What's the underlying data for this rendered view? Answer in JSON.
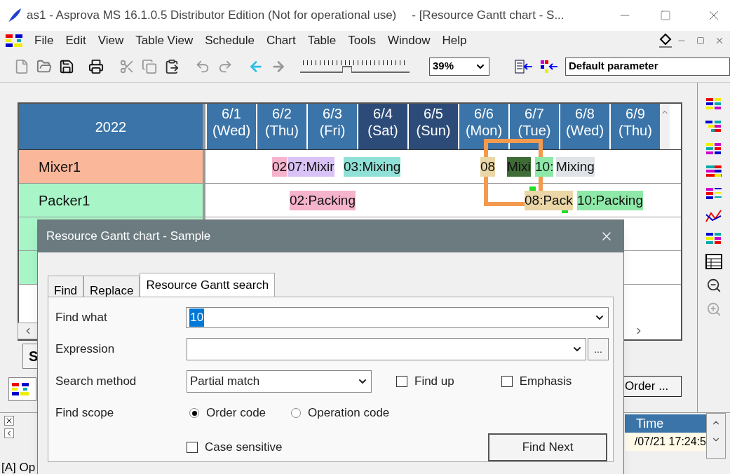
{
  "window": {
    "title": "as1 - Asprova MS 16.1.0.5 Distributor Edition (Not for operational use)",
    "document": "- [Resource Gantt chart - S..."
  },
  "menu": [
    "File",
    "Edit",
    "View",
    "Table View",
    "Schedule",
    "Chart",
    "Table",
    "Tools",
    "Window",
    "Help"
  ],
  "toolbar": {
    "zoom_slider": {
      "level": 0.42
    },
    "zoom": "39%",
    "parameter": "Default parameter"
  },
  "gantt": {
    "year": "2022",
    "days": [
      {
        "date": "6/1",
        "weekday": "(Wed)",
        "weekend": false
      },
      {
        "date": "6/2",
        "weekday": "(Thu)",
        "weekend": false
      },
      {
        "date": "6/3",
        "weekday": "(Fri)",
        "weekend": false
      },
      {
        "date": "6/4",
        "weekday": "(Sat)",
        "weekend": true
      },
      {
        "date": "6/5",
        "weekday": "(Sun)",
        "weekend": true
      },
      {
        "date": "6/6",
        "weekday": "(Mon)",
        "weekend": false
      },
      {
        "date": "6/7",
        "weekday": "(Tue)",
        "weekend": false
      },
      {
        "date": "6/8",
        "weekday": "(Wed)",
        "weekend": false
      },
      {
        "date": "6/9",
        "weekday": "(Thu)",
        "weekend": false
      }
    ],
    "rows": [
      {
        "name": "Mixer1",
        "color": "#fbb79a",
        "bars": [
          {
            "label": "02",
            "color": "#f5b3cc"
          },
          {
            "label": "07:Mixir",
            "color": "#d9c2f5"
          },
          {
            "label": "03:Mixing",
            "color": "#8fe0d6"
          },
          {
            "label": "08",
            "color": "#ead6a6"
          },
          {
            "label": "Mixi",
            "color": "#3f6b36"
          },
          {
            "label": "10:",
            "color": "#8ee8a8"
          },
          {
            "label": "Mixing",
            "color": "#dfe3e7"
          }
        ]
      },
      {
        "name": "Packer1",
        "color": "#a8f5c8",
        "bars": [
          {
            "label": "02:Packing",
            "color": "#f5b3cc"
          },
          {
            "label": "08:Pack",
            "color": "#ead6a6"
          },
          {
            "label": "10:Packing",
            "color": "#8ee8a8"
          }
        ]
      },
      {
        "color": "#a8f5c8",
        "bars": []
      },
      {
        "color": "#a8f5c8",
        "bars": []
      }
    ],
    "tab_letter": "S",
    "order_tab": "Order ..."
  },
  "output": {
    "column": "Time",
    "cell": "/07/21 17:24:5"
  },
  "status_bar": "[A] Op",
  "dialog": {
    "title": "Resource Gantt chart - Sample",
    "tabs": [
      {
        "label": "Find",
        "selected": false
      },
      {
        "label": "Replace",
        "selected": false
      },
      {
        "label": "Resource Gantt search",
        "selected": true
      }
    ],
    "find_what": {
      "label": "Find what",
      "value": "10"
    },
    "expression": {
      "label": "Expression",
      "more": "..."
    },
    "search_method": {
      "label": "Search method",
      "value": "Partial match"
    },
    "find_up": {
      "label": "Find up",
      "checked": false
    },
    "emphasis": {
      "label": "Emphasis",
      "checked": false
    },
    "find_scope": {
      "label": "Find scope",
      "options": [
        {
          "label": "Order code",
          "selected": true
        },
        {
          "label": "Operation code",
          "selected": false
        }
      ]
    },
    "case_sensitive": {
      "label": "Case sensitive",
      "checked": false
    },
    "button": "Find Next"
  }
}
